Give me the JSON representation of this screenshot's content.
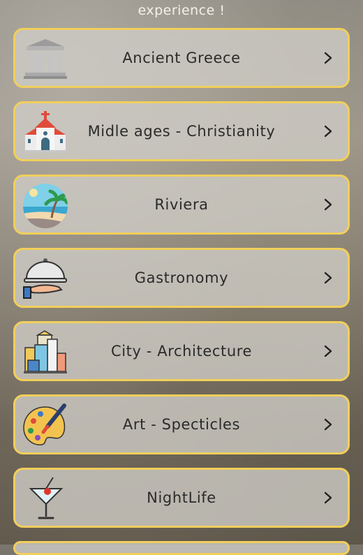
{
  "header": {
    "subtitle": "experience !"
  },
  "categories": [
    {
      "label": "Ancient Greece",
      "icon": "greek-temple-icon"
    },
    {
      "label": "Midle ages - Christianity",
      "icon": "church-icon"
    },
    {
      "label": "Riviera",
      "icon": "palm-beach-icon"
    },
    {
      "label": "Gastronomy",
      "icon": "food-cloche-icon"
    },
    {
      "label": "City - Architecture",
      "icon": "city-buildings-icon"
    },
    {
      "label": "Art - Specticles",
      "icon": "paint-palette-icon"
    },
    {
      "label": "NightLife",
      "icon": "cocktail-glass-icon"
    }
  ],
  "colors": {
    "card_border": "#f1cf5b",
    "text": "#2b2b2b"
  }
}
